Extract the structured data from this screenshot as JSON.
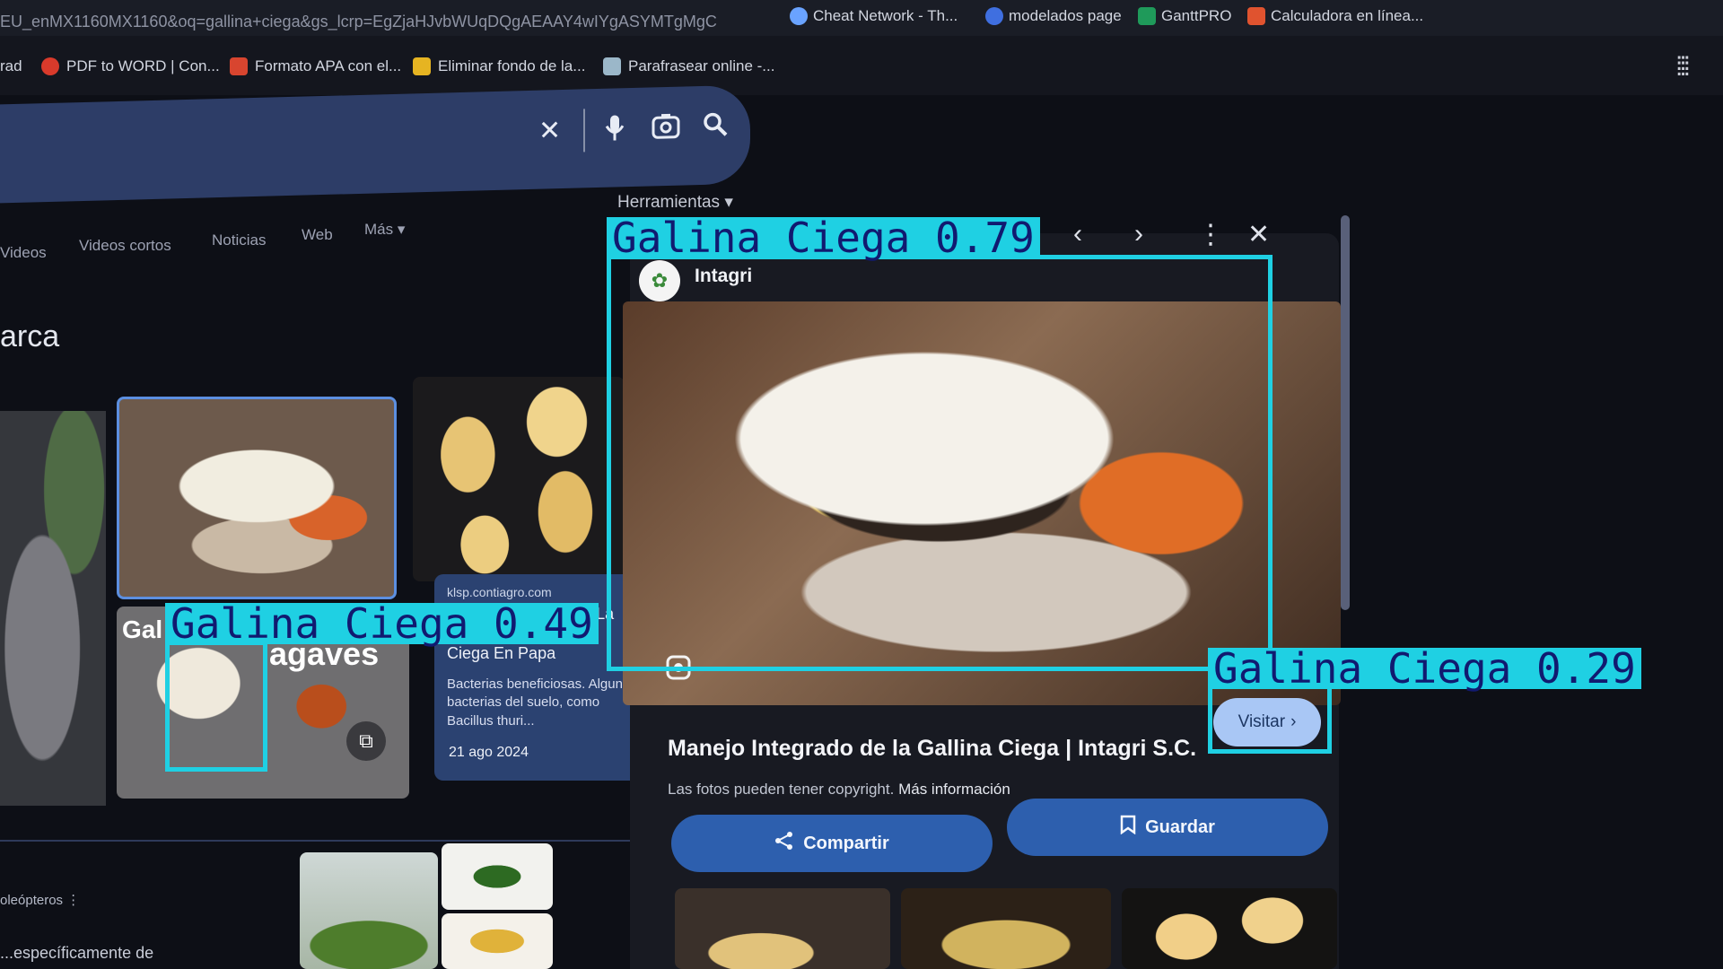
{
  "browser": {
    "url_fragment": "EU_enMX1160MX1160&oq=gallina+ciega&gs_lcrp=EgZjaHJvbWUqDQgAEAAY4wIYgASYMTgMgC",
    "bookmarks_top": [
      {
        "label": "Cheat Network - Th...",
        "icon_color": "#6aa3ff"
      },
      {
        "label": "modelados page",
        "icon_color": "#3f6fe0"
      },
      {
        "label": "GanttPRO",
        "icon_color": "#1f9a5a"
      },
      {
        "label": "Calculadora en línea...",
        "icon_color": "#e0532f"
      }
    ],
    "bookmarks": [
      {
        "label": "rad",
        "icon_color": ""
      },
      {
        "label": "PDF to WORD | Con...",
        "icon_color": "#d93a2b"
      },
      {
        "label": "Formato APA con el...",
        "icon_color": "#d8452f"
      },
      {
        "label": "Eliminar fondo de la...",
        "icon_color": "#e6b422"
      },
      {
        "label": "Parafrasear online -...",
        "icon_color": "#9bb7c9"
      }
    ],
    "apps_icon": "apps-grid-icon"
  },
  "search": {
    "icons": [
      "clear-icon",
      "microphone-icon",
      "camera-lens-icon",
      "search-icon"
    ]
  },
  "tabs": [
    "Videos",
    "Videos cortos",
    "Noticias",
    "Web",
    "Más"
  ],
  "tools_label": "Herramientas",
  "heading": "arca",
  "grid": {
    "caption_left": "Gal",
    "caption_right": "agaves",
    "info_card": {
      "source": "klsp.contiagro.com",
      "title_line1": "Control Biológico de La Gallina",
      "title_line2": "Ciega En Papa",
      "description": "Bacterias beneficiosas. Algunas bacterias del suelo, como Bacillus thuri...",
      "date": "21 ago 2024"
    },
    "lower_label": "oleópteros",
    "lower_text": "...específicamente de"
  },
  "preview": {
    "source": "Intagri",
    "title": "Manejo Integrado de la Gallina Ciega | Intagri S.C.",
    "visit_label": "Visitar",
    "copyright": "Las fotos pueden tener copyright.",
    "more_info": "Más información",
    "share_label": "Compartir",
    "save_label": "Guardar"
  },
  "detections": [
    {
      "label": "Galina Ciega 0.79",
      "class": "Galina Ciega",
      "score": 0.79
    },
    {
      "label": "Galina Ciega 0.49",
      "class": "Galina Ciega",
      "score": 0.49
    },
    {
      "label": "Galina Ciega 0.29",
      "class": "Galina Ciega",
      "score": 0.29
    }
  ],
  "colors": {
    "detection": "#1fd0e3",
    "detection_text": "#111a70",
    "searchbar": "#2d3d67",
    "primary_button": "#2d5fae",
    "visit_button": "#a9c7f5"
  }
}
